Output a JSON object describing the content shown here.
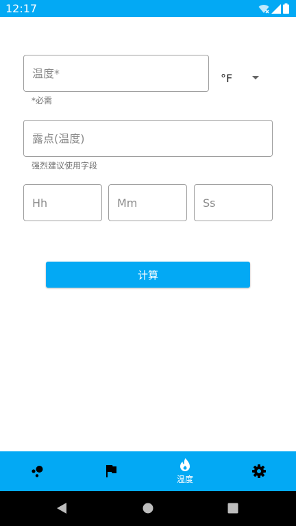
{
  "status_bar": {
    "time": "12:17",
    "icons": [
      "wifi-icon",
      "signal-icon",
      "battery-icon"
    ]
  },
  "temperature": {
    "placeholder": "温度*",
    "helper": "*必需"
  },
  "unit": {
    "selected": "°F"
  },
  "dewpoint": {
    "placeholder": "露点(温度)",
    "helper": "强烈建议使用字段"
  },
  "time_fields": {
    "hh_placeholder": "Hh",
    "mm_placeholder": "Mm",
    "ss_placeholder": "Ss"
  },
  "calculate_button": {
    "label": "计算"
  },
  "bottom_nav": {
    "items": [
      {
        "icon": "bubbles-icon",
        "label": ""
      },
      {
        "icon": "flag-icon",
        "label": ""
      },
      {
        "icon": "flame-icon",
        "label": "温度",
        "active": true
      },
      {
        "icon": "gear-icon",
        "label": ""
      }
    ]
  },
  "colors": {
    "accent": "#03a9f4",
    "system_nav": "#000000",
    "background": "#ffffff"
  }
}
